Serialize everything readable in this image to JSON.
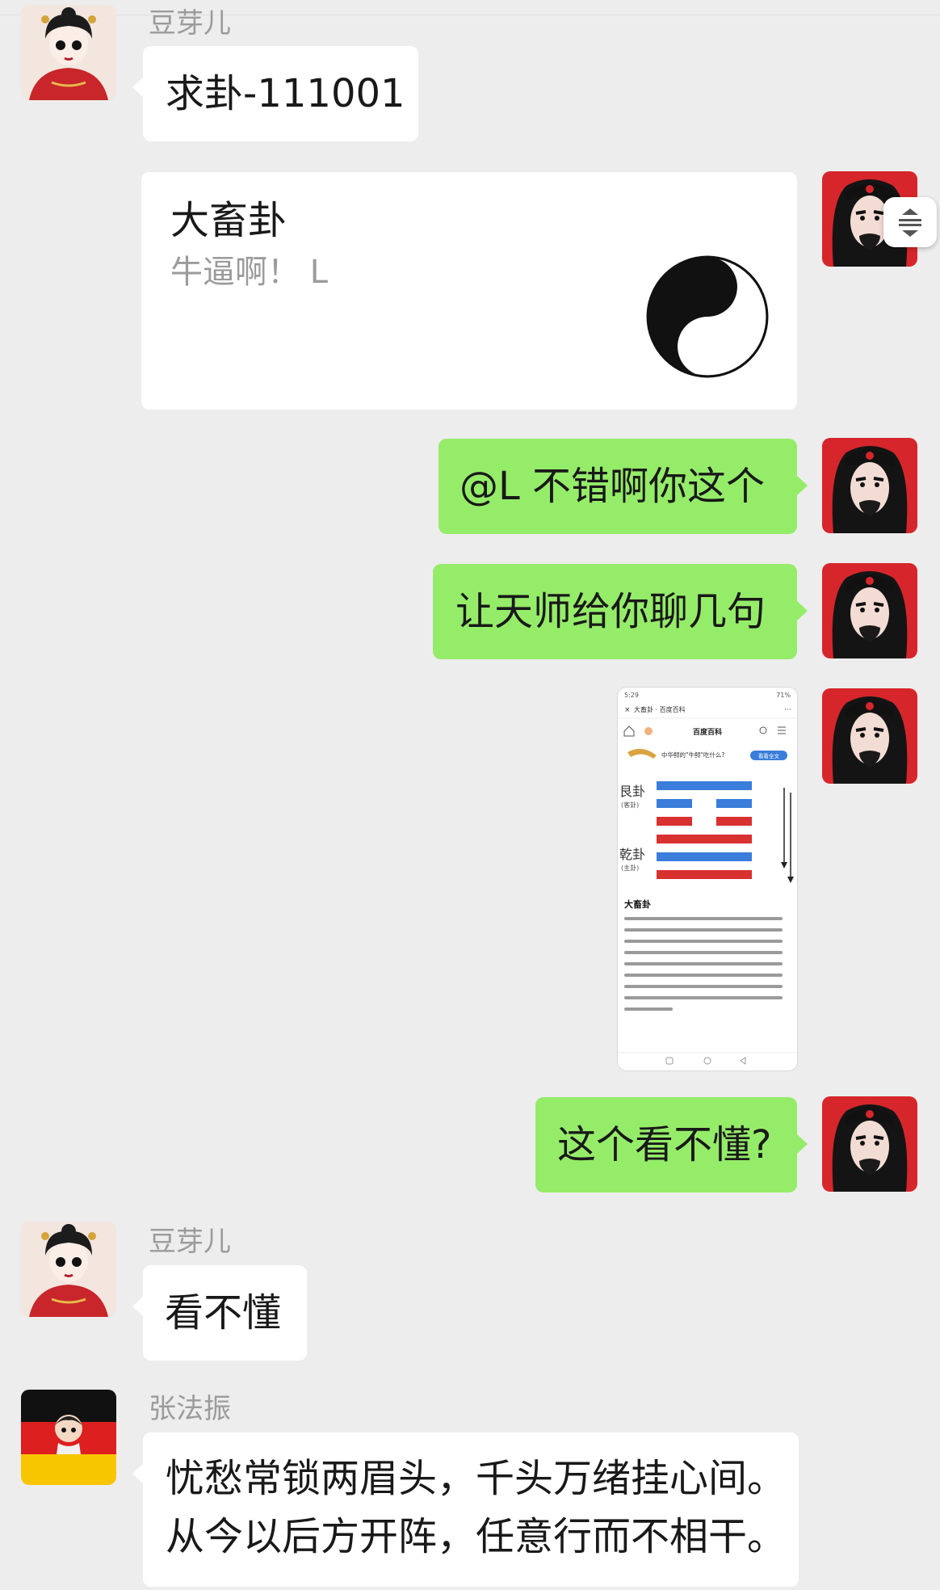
{
  "messages": {
    "m1": {
      "sender": "豆芽儿",
      "text": "求卦-111001"
    },
    "m2": {
      "title": "大畜卦",
      "subtitle": "牛逼啊！ L"
    },
    "m3": {
      "text": "@L  不错啊你这个"
    },
    "m4": {
      "text": "让天师给你聊几句"
    },
    "m5": {
      "screenshot": {
        "status_time": "5:29",
        "status_right": "71%",
        "page_title": "大畜卦 · 百度百科",
        "site_name": "百度百科",
        "banner": "中华鲟的\"牛鲟\"吃什么?",
        "banner_button": "看看全文",
        "upper_trigram": "艮卦",
        "upper_note": "(客卦)",
        "lower_trigram": "乾卦",
        "lower_note": "(主卦)",
        "lines": [
          "solid",
          "broken",
          "broken",
          "solid",
          "solid",
          "solid"
        ],
        "line_colors": [
          "#3a7ddb",
          "#3a7ddb",
          "#d93030",
          "#d93030",
          "#3a7ddb",
          "#d93030"
        ],
        "article_title": "大畜卦"
      }
    },
    "m6": {
      "text": "这个看不懂?"
    },
    "m7": {
      "sender": "豆芽儿",
      "text": "看不懂"
    },
    "m8": {
      "sender": "张法振",
      "line1": "忧愁常锁两眉头，千头万绪挂心间。",
      "line2": "从今以后方开阵，任意行而不相干。"
    }
  },
  "colors": {
    "background": "#ededed",
    "bubble_self": "#95ec69",
    "bubble_other": "#ffffff",
    "name_text": "#9b9b9b"
  },
  "icons": {
    "avatar_douyaer": "bride-avatar",
    "avatar_self": "bearded-man-avatar",
    "avatar_zhang": "german-flag-avatar",
    "card": "yin-yang-icon",
    "scroll": "scroll-handle-icon"
  }
}
